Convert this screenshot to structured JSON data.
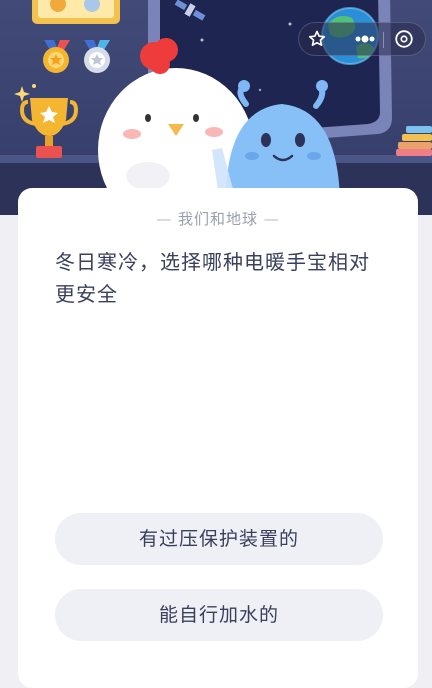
{
  "quiz": {
    "category": "我们和地球",
    "question": "冬日寒冷，选择哪种电暖手宝相对更安全",
    "options": [
      {
        "label": "有过压保护装置的"
      },
      {
        "label": "能自行加水的"
      }
    ]
  },
  "capsule": {
    "icons": [
      "star-icon",
      "more-dots-icon",
      "close-circle-icon"
    ]
  },
  "scene": {
    "icons": [
      "trophy-icon",
      "medal-gold-icon",
      "medal-silver-icon",
      "chicken-mascot",
      "alien-mascot",
      "earth-planet"
    ]
  },
  "colors": {
    "scene_bg": "#3c4472",
    "card_bg": "#ffffff",
    "option_bg": "#eef0f5",
    "question_text": "#3a3f5c",
    "category_text": "#9aa0ac",
    "trophy": "#f4b531"
  }
}
